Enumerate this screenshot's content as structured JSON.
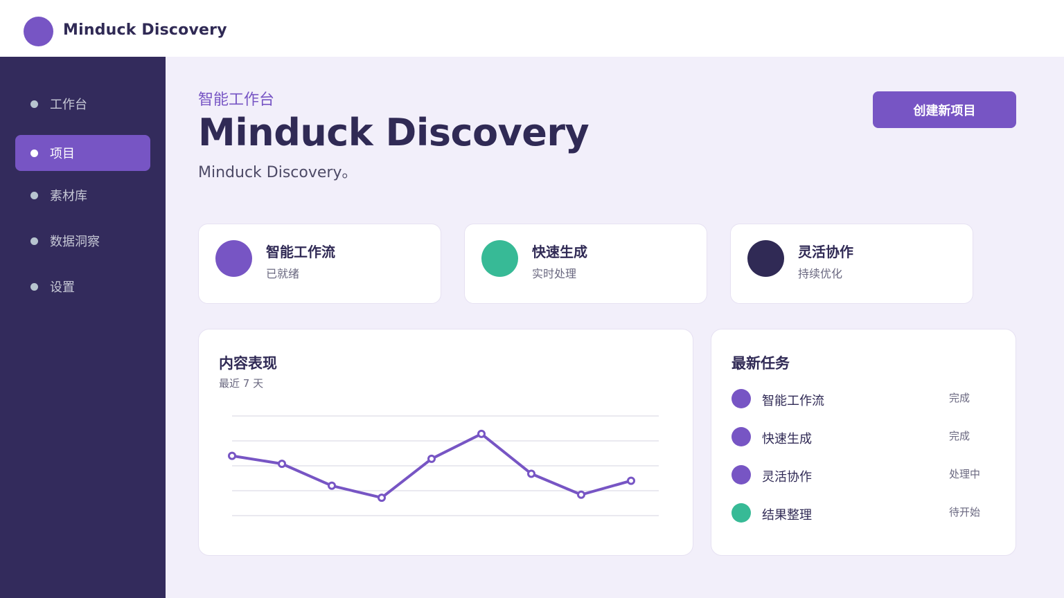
{
  "app": {
    "brand": "Minduck Discovery",
    "accent": "#7755c4",
    "green": "#37ba96",
    "navy": "#332b5c"
  },
  "sidebar": {
    "items": [
      {
        "label": "工作台",
        "active": false
      },
      {
        "label": "项目",
        "active": true
      },
      {
        "label": "素材库",
        "active": false
      },
      {
        "label": "数据洞察",
        "active": false
      },
      {
        "label": "设置",
        "active": false
      }
    ]
  },
  "hero": {
    "eyebrow": "智能工作台",
    "title": "Minduck Discovery",
    "subtitle": "Minduck Discovery。",
    "create_label": "创建新项目"
  },
  "stats": [
    {
      "title": "智能工作流",
      "sub": "已就绪",
      "color": "#7755c4"
    },
    {
      "title": "快速生成",
      "sub": "实时处理",
      "color": "#37ba96"
    },
    {
      "title": "灵活协作",
      "sub": "持续优化",
      "color": "#302a55"
    }
  ],
  "performance": {
    "title": "内容表现",
    "subtitle": "最近 7 天"
  },
  "chart_data": {
    "type": "line",
    "title": "内容表现",
    "subtitle": "最近 7 天",
    "xlabel": "",
    "ylabel": "",
    "ylim": [
      0,
      100
    ],
    "grid": true,
    "x": [
      1,
      2,
      3,
      4,
      5,
      6,
      7,
      8,
      9
    ],
    "series": [
      {
        "values": [
          60,
          52,
          30,
          18,
          57,
          82,
          42,
          21,
          35
        ],
        "color": "#7755c4"
      }
    ]
  },
  "tasks": {
    "title": "最新任务",
    "items": [
      {
        "label": "智能工作流",
        "status": "完成",
        "color": "#7755c4"
      },
      {
        "label": "快速生成",
        "status": "完成",
        "color": "#7755c4"
      },
      {
        "label": "灵活协作",
        "status": "处理中",
        "color": "#7755c4"
      },
      {
        "label": "结果整理",
        "status": "待开始",
        "color": "#37ba96"
      }
    ]
  }
}
